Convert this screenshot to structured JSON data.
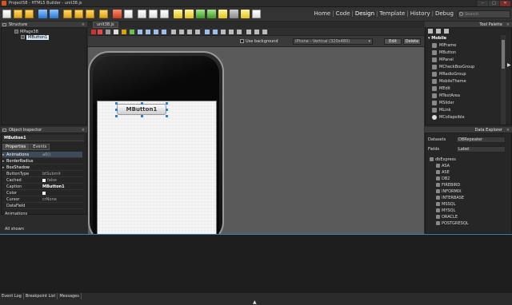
{
  "window": {
    "title": "Project58 - HTML5 Builder - unit38.js",
    "controls": {
      "minimize": "–",
      "maximize": "□",
      "close": "✕"
    }
  },
  "toolbar": {
    "modes": [
      "Home",
      "Code",
      "Design",
      "Template",
      "History",
      "Debug"
    ],
    "separator": "|",
    "active_mode": "Design",
    "search_placeholder": "Search"
  },
  "structure": {
    "title": "Structure",
    "close": "×",
    "items": [
      {
        "label": "MPage38"
      },
      {
        "label": "MButton1"
      }
    ]
  },
  "inspector": {
    "title": "Object Inspector",
    "close": "×",
    "selected_object": "MButton1",
    "tabs": [
      "Properties",
      "Events"
    ],
    "rows": [
      {
        "name": "Animations",
        "value": "a0()",
        "group": true
      },
      {
        "name": "BorderRadius",
        "value": "",
        "group": true
      },
      {
        "name": "BoxShadow",
        "value": "",
        "group": true
      },
      {
        "name": "ButtonType",
        "value": "btSubmit"
      },
      {
        "name": "Cached",
        "value": "false"
      },
      {
        "name": "Caption",
        "value": "MButton1"
      },
      {
        "name": "Color",
        "value": ""
      },
      {
        "name": "Cursor",
        "value": "crNone"
      },
      {
        "name": "DataField",
        "value": ""
      }
    ],
    "description": "Animations",
    "shown": "All shown"
  },
  "designer": {
    "tab": "unit38.js",
    "use_background": "Use background",
    "device": "iPhone - Vertical (320x480)",
    "device_arrow": "▾",
    "edit": "Edit",
    "delete": "Delete",
    "button_caption": "MButton1"
  },
  "palette": {
    "title": "Tool Palette",
    "close": "×",
    "category": "Mobile",
    "items": [
      "MIFrame",
      "MButton",
      "MPanel",
      "MCheckBoxGroup",
      "MRadioGroup",
      "MobileTheme",
      "MEdit",
      "MTextArea",
      "MSlider",
      "MLink",
      "MCollapsible"
    ]
  },
  "explorer": {
    "title": "Data Explorer",
    "close": "×",
    "datasets_label": "Datasets",
    "datasets_value": "DBRepeater",
    "fields_label": "Fields",
    "fields_value": "Label",
    "root": "dbExpress",
    "drivers": [
      "ASA",
      "ASE",
      "DB2",
      "FIREBIRD",
      "INFORMIX",
      "INTERBASE",
      "MSSQL",
      "MYSQL",
      "ORACLE",
      "POSTGRESQL"
    ]
  },
  "bottom": {
    "tabs": [
      "Event Log",
      "Breakpoint List",
      "Messages"
    ],
    "up_arrow": "▲",
    "right_arrow": "▶"
  }
}
